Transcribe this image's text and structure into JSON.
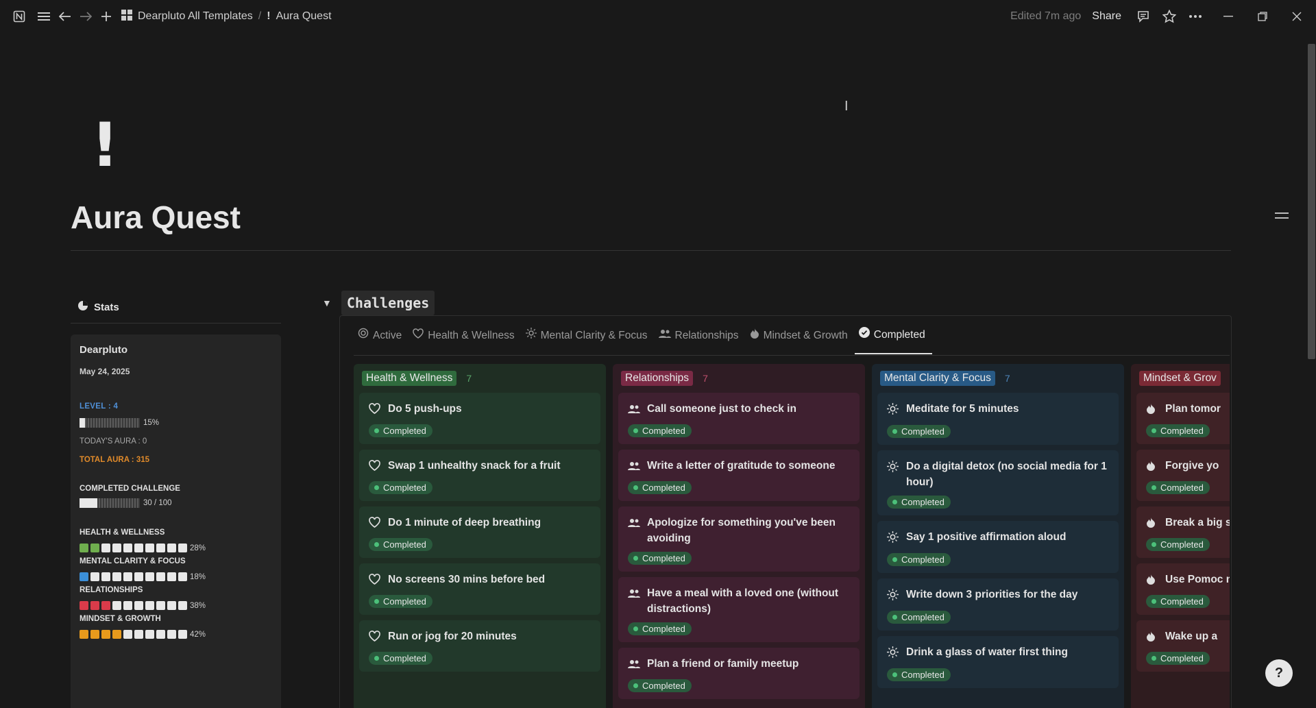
{
  "topbar": {
    "breadcrumb_root": "Dearpluto All Templates",
    "breadcrumb_sep": "/",
    "breadcrumb_page": "Aura Quest",
    "edited": "Edited 7m ago",
    "share": "Share"
  },
  "page": {
    "icon": "!",
    "title": "Aura Quest"
  },
  "stats": {
    "heading": "Stats",
    "name": "Dearpluto",
    "date": "May 24, 2025",
    "level": "LEVEL :  4",
    "level_pct_label": "15%",
    "level_progress": 0.15,
    "today_aura": "TODAY'S AURA : 0",
    "total_aura": "TOTAL AURA : 315",
    "completed_label": "COMPLETED CHALLENGE",
    "completed_value": "30 / 100",
    "completed_progress": 0.3,
    "categories": [
      {
        "label": "HEALTH & WELLNESS",
        "pct": "28%",
        "filled": 2,
        "color": "#6fae4e"
      },
      {
        "label": "MENTAL CLARITY & FOCUS",
        "pct": "18%",
        "filled": 1,
        "color": "#3b8fd9"
      },
      {
        "label": "RELATIONSHIPS",
        "pct": "38%",
        "filled": 3,
        "color": "#d93b4a"
      },
      {
        "label": "MINDSET & GROWTH",
        "pct": "42%",
        "filled": 4,
        "color": "#e89a1c"
      }
    ]
  },
  "challenges": {
    "title": "Challenges",
    "tabs": [
      "Active",
      "Health & Wellness",
      "Mental Clarity & Focus",
      "Relationships",
      "Mindset & Growth",
      "Completed"
    ],
    "status": "Completed",
    "columns": [
      {
        "name": "Health & Wellness",
        "count": "7",
        "cards": [
          "Do 5 push-ups",
          "Swap 1 unhealthy snack for a fruit",
          "Do 1 minute of deep breathing",
          "No screens 30 mins before bed",
          "Run or jog for 20 minutes"
        ]
      },
      {
        "name": "Relationships",
        "count": "7",
        "cards": [
          "Call someone just to check in",
          "Write a letter of gratitude to someone",
          "Apologize for something you've been avoiding",
          "Have a meal with a loved one (without distractions)",
          "Plan a friend or family meetup"
        ]
      },
      {
        "name": "Mental Clarity & Focus",
        "count": "7",
        "cards": [
          "Meditate for 5 minutes",
          "Do a digital detox (no social media for 1 hour)",
          "Say 1 positive affirmation aloud",
          "Write down 3 priorities for the day",
          "Drink a glass of water first thing"
        ]
      },
      {
        "name": "Mindset & Grov",
        "count": "",
        "cards": [
          "Plan tomor",
          "Forgive yo",
          "Break a big steps",
          "Use Pomoc mins (just",
          "Wake up a"
        ]
      }
    ]
  },
  "colors": {
    "health": "#22392b",
    "relationships": "#3f2030",
    "mental": "#1e2d38",
    "mindset": "#3f2226"
  }
}
